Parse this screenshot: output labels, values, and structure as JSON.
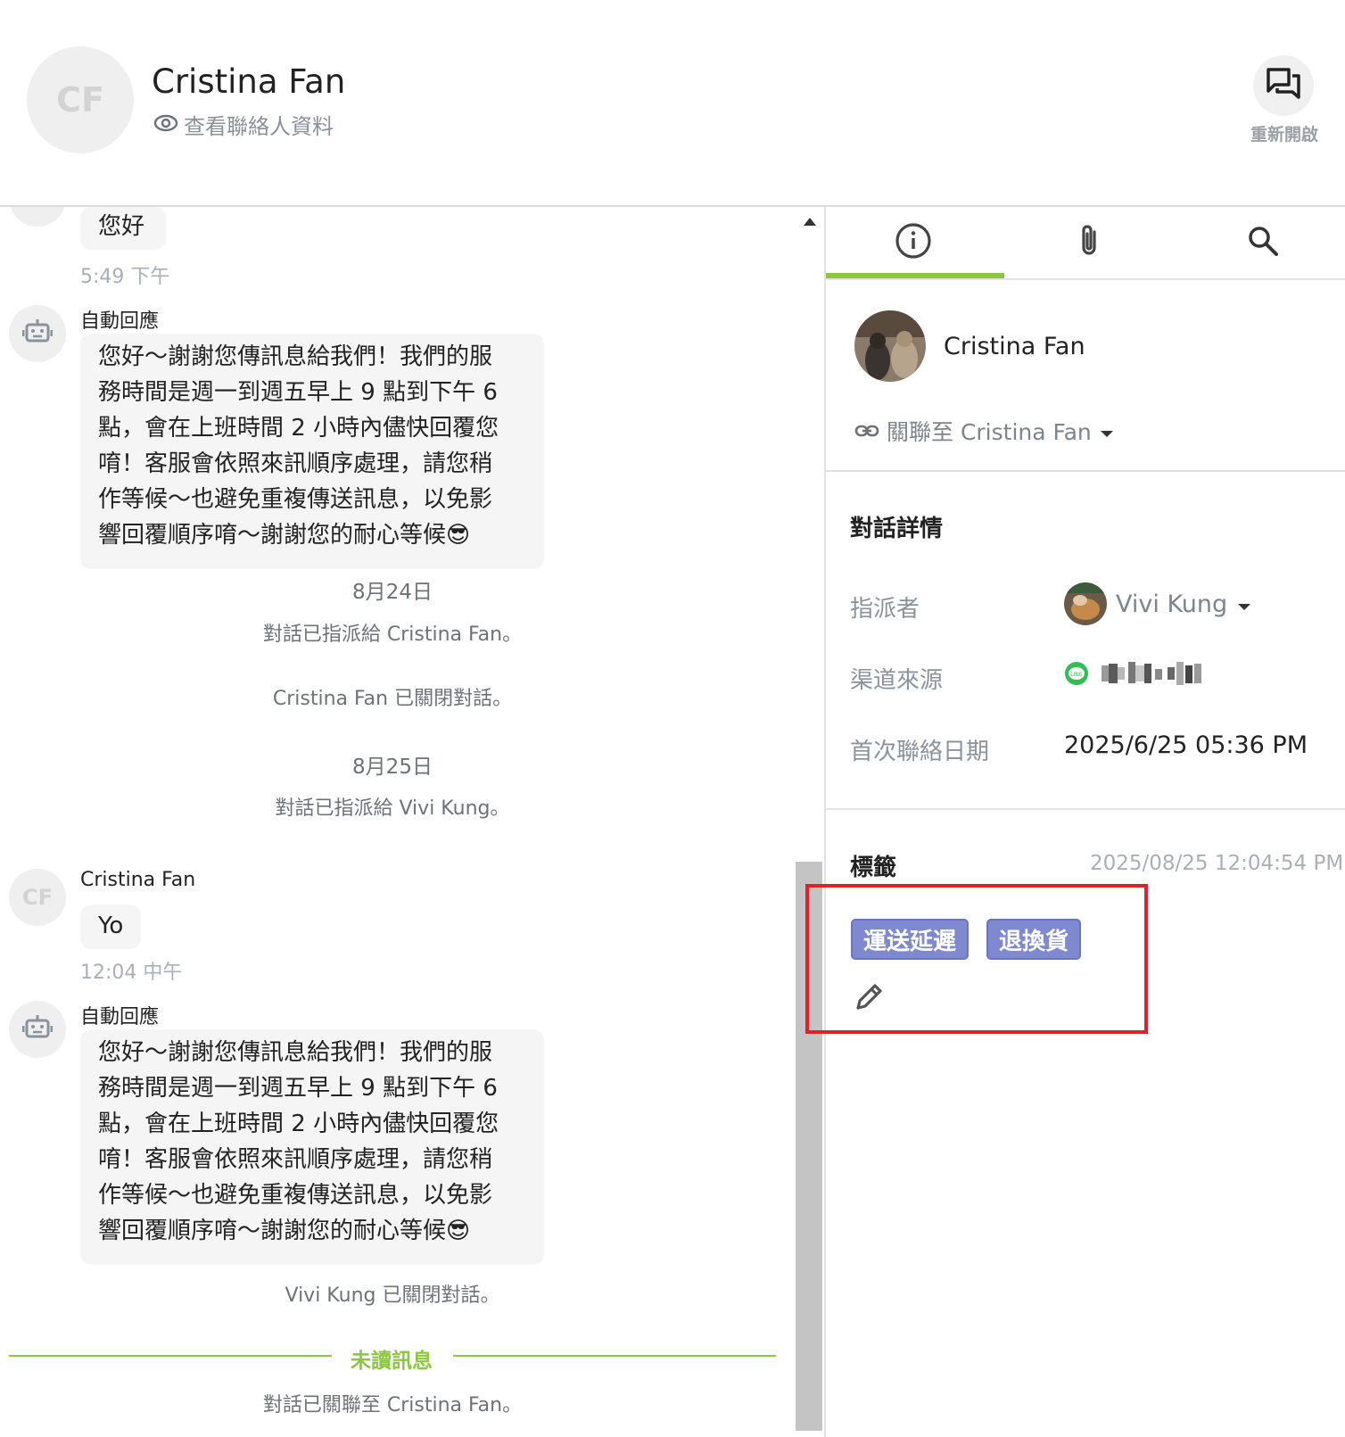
{
  "header": {
    "avatar_initials": "CF",
    "contact_name": "Cristina Fan",
    "view_contact_label": "查看聯絡人資料",
    "reopen_label": "重新開啟"
  },
  "chat": {
    "messages": [
      {
        "type": "contact",
        "text": "您好",
        "time": "5:49 下午"
      },
      {
        "type": "bot",
        "sender": "自動回應",
        "lines": [
          "您好～謝謝您傳訊息給我們！我們的服",
          "務時間是週一到週五早上 9 點到下午 6",
          "點，會在上班時間 2 小時內儘快回覆您",
          "唷！客服會依照來訊順序處理，請您稍",
          "作等候～也避免重複傳送訊息，以免影",
          "響回覆順序唷～謝謝您的耐心等候"
        ],
        "emoji": "😎"
      },
      {
        "type": "date",
        "text": "8月24日"
      },
      {
        "type": "system",
        "text": "對話已指派給 Cristina Fan。"
      },
      {
        "type": "system",
        "text": "Cristina Fan 已關閉對話。"
      },
      {
        "type": "date",
        "text": "8月25日"
      },
      {
        "type": "system",
        "text": "對話已指派給 Vivi Kung。"
      },
      {
        "type": "contact",
        "sender": "Cristina Fan",
        "avatar_initials": "CF",
        "text": "Yo",
        "time": "12:04 中午"
      },
      {
        "type": "bot",
        "sender": "自動回應",
        "lines": [
          "您好～謝謝您傳訊息給我們！我們的服",
          "務時間是週一到週五早上 9 點到下午 6",
          "點，會在上班時間 2 小時內儘快回覆您",
          "唷！客服會依照來訊順序處理，請您稍",
          "作等候～也避免重複傳送訊息，以免影",
          "響回覆順序唷～謝謝您的耐心等候"
        ],
        "emoji": "😎"
      },
      {
        "type": "system",
        "text": "Vivi Kung 已關閉對話。"
      },
      {
        "type": "system",
        "text": "對話已關聯至 Cristina Fan。"
      }
    ],
    "unread_label": "未讀訊息"
  },
  "panel": {
    "tabs": [
      {
        "name": "info",
        "icon": "info-icon",
        "active": true
      },
      {
        "name": "attachments",
        "icon": "paperclip-icon",
        "active": false
      },
      {
        "name": "search",
        "icon": "search-icon",
        "active": false
      }
    ],
    "profile_name": "Cristina Fan",
    "link_label": "關聯至 Cristina Fan",
    "details_title": "對話詳情",
    "assignee_label": "指派者",
    "assignee_value": "Vivi Kung",
    "channel_label": "渠道來源",
    "channel_icon": "line-icon",
    "first_contact_label": "首次聯絡日期",
    "first_contact_value": "2025/6/25 05:36 PM",
    "tags_title": "標籤",
    "tags_time": "2025/08/25 12:04:54 PM",
    "tags": [
      "運送延遲",
      "退換貨"
    ]
  },
  "colors": {
    "accent_green": "#8dc63f",
    "tag_purple": "#7e89cf",
    "highlight_red": "#e0202a"
  }
}
